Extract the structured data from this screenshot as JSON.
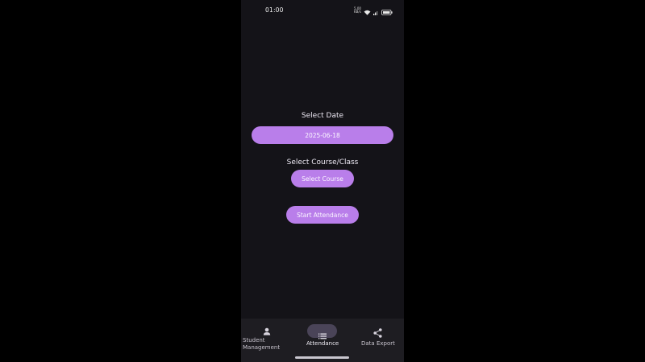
{
  "status_bar": {
    "time": "01:00",
    "speed": "5.00\nKB/s",
    "network": "4G",
    "battery": "57"
  },
  "main": {
    "select_date_label": "Select Date",
    "date_value": "2025-06-18",
    "select_course_label": "Select Course/Class",
    "select_course_button": "Select Course",
    "start_attendance_button": "Start Attendance"
  },
  "bottom_nav": {
    "items": [
      {
        "label_line1": "Student",
        "label_line2": "Management",
        "icon": "person-icon"
      },
      {
        "label": "Attendance",
        "icon": "list-icon",
        "active": true
      },
      {
        "label": "Data Export",
        "icon": "share-icon"
      }
    ]
  },
  "colors": {
    "background": "#141318",
    "accent": "#b97eea",
    "nav_background": "#1e1d22",
    "active_indicator": "#4a4458"
  }
}
